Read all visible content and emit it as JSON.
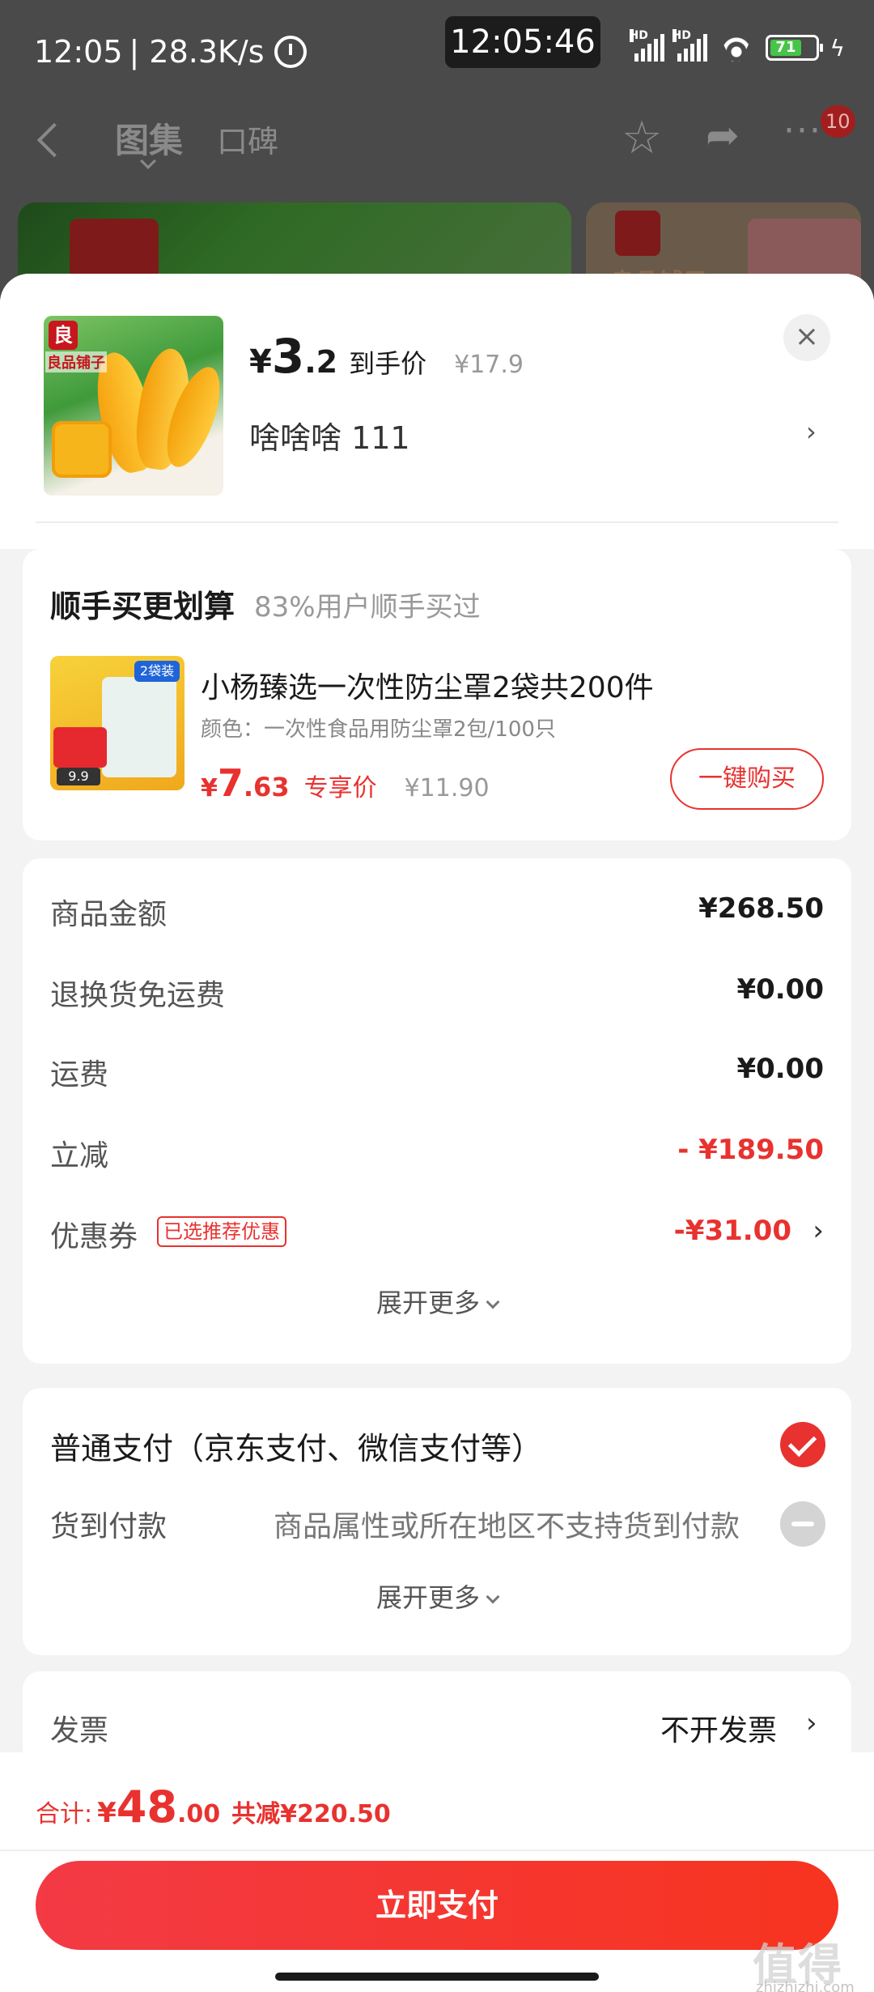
{
  "status_bar": {
    "time": "12:05",
    "speed": "| 28.3K/s",
    "clock_overlay": "12:05:46",
    "hd1": "HD",
    "hd2": "HD",
    "battery": "71"
  },
  "nav": {
    "tab_gallery": "图集",
    "tab_reviews": "口碑",
    "badge_count": "10",
    "bg_brand_text": "良品铺子"
  },
  "product": {
    "price_symbol": "¥",
    "price_int": "3",
    "price_dec": ".2",
    "price_label": "到手价",
    "original_price": "¥17.9",
    "variant": "啥啥啥  111",
    "brand_short": "良",
    "brand_name": "良品铺子"
  },
  "upsell": {
    "title": "顺手买更划算",
    "subtitle": "83%用户顺手买过",
    "name": "小杨臻选一次性防尘罩2袋共200件",
    "spec": "颜色：一次性食品用防尘罩2包/100只",
    "price_symbol": "¥",
    "price_int": "7",
    "price_dec": ".63",
    "price_label": "专享价",
    "original_price": "¥11.90",
    "buy_label": "一键购买",
    "img_tag": "2袋装",
    "img_price": "9.9"
  },
  "summary": {
    "rows": [
      {
        "label": "商品金额",
        "value": "¥268.50"
      },
      {
        "label": "退换货免运费",
        "value": "¥0.00"
      },
      {
        "label": "运费",
        "value": "¥0.00"
      },
      {
        "label": "立减",
        "value": "- ¥189.50"
      },
      {
        "label": "优惠券",
        "value": "-¥31.00",
        "tag": "已选推荐优惠"
      }
    ],
    "expand_label": "展开更多"
  },
  "payment": {
    "normal_label": "普通支付（京东支付、微信支付等）",
    "cod_label": "货到付款",
    "cod_note": "商品属性或所在地区不支持货到付款",
    "expand_label": "展开更多"
  },
  "invoice": {
    "label": "发票",
    "value": "不开发票"
  },
  "footer": {
    "total_label": "合计:",
    "total_symbol": "¥",
    "total_int": "48",
    "total_dec": ".00",
    "saved": "共减¥220.50",
    "pay_button": "立即支付",
    "watermark": "值得值",
    "watermark_sub": "zhizhizhi.com"
  },
  "colors": {
    "accent": "#e8322f",
    "checked": "#e8322f",
    "disabled": "#d4d4d4"
  },
  "icons": [
    "back-icon",
    "star-icon",
    "share-icon",
    "more-icon",
    "alarm-icon",
    "wifi-icon",
    "battery-icon",
    "close-icon",
    "chevron-right-icon",
    "check-icon",
    "disabled-icon"
  ]
}
